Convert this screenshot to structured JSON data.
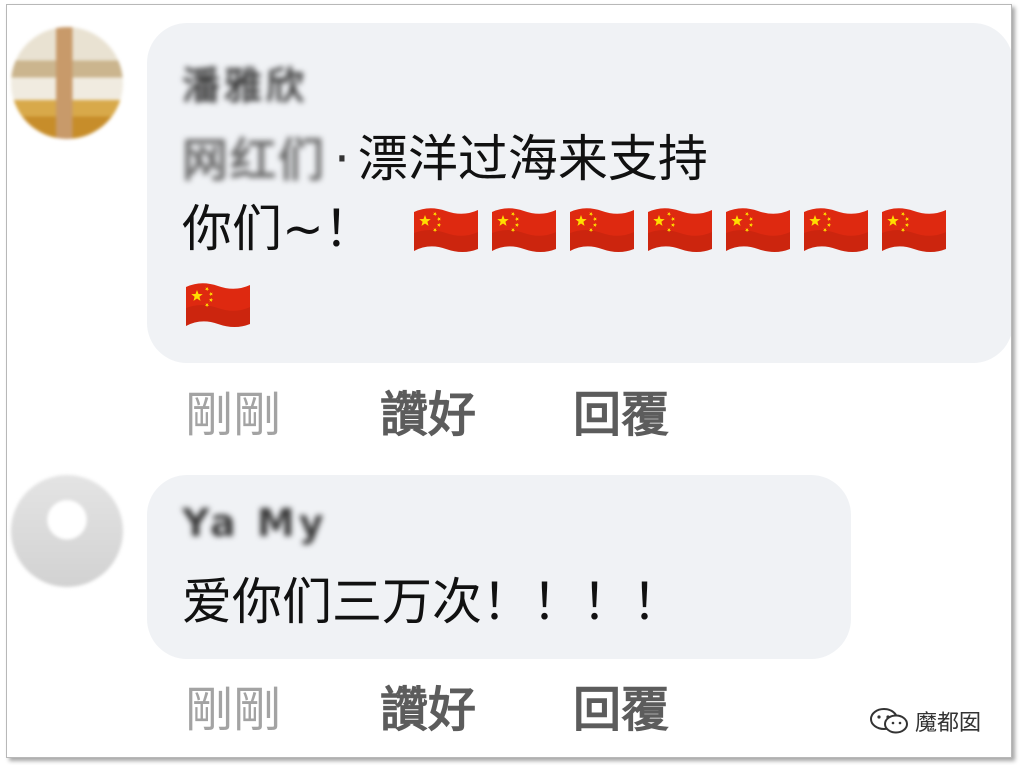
{
  "comments": [
    {
      "author": "潘雅欣",
      "mention": "网红们",
      "separator": "·",
      "text_line1": "漂洋过海来支持",
      "text_line2": "你们~！",
      "flag_count": 8,
      "time": "剛剛",
      "like_label": "讚好",
      "reply_label": "回覆"
    },
    {
      "author": "Ya My",
      "text_line1": "爱你们三万次！！！！",
      "time": "剛剛",
      "like_label": "讚好",
      "reply_label": "回覆"
    }
  ],
  "watermark": {
    "text": "魔都囡",
    "icon": "wechat-icon"
  },
  "colors": {
    "bubble": "#f0f2f5",
    "flag_red": "#de2910",
    "flag_star": "#ffde00",
    "action_text": "#5c5c5c",
    "time_text": "#a3a3a3"
  }
}
